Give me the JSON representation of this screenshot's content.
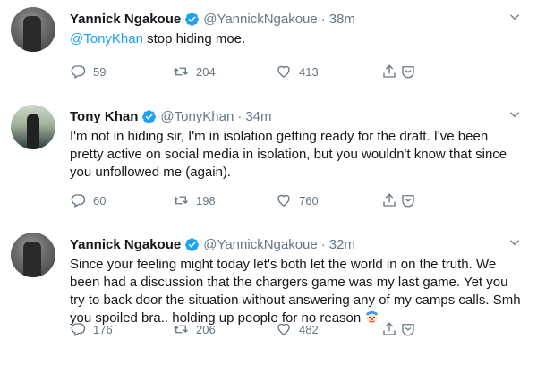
{
  "tweets": [
    {
      "name": "Yannick Ngakoue",
      "handle": "@YannickNgakoue",
      "separator": "·",
      "time": "38m",
      "mention": "@TonyKhan",
      "text": " stop hiding moe.",
      "replies": "59",
      "retweets": "204",
      "likes": "413"
    },
    {
      "name": "Tony Khan",
      "handle": "@TonyKhan",
      "separator": "·",
      "time": "34m",
      "text": "I'm not in hiding sir, I'm in isolation getting ready for the draft. I've been pretty active on social media in isolation, but you wouldn't know that since you unfollowed me (again).",
      "replies": "60",
      "retweets": "198",
      "likes": "760"
    },
    {
      "name": "Yannick Ngakoue",
      "handle": "@YannickNgakoue",
      "separator": "·",
      "time": "32m",
      "text": "Since your feeling might today let's both let the world in on the truth. We been had a discussion that the chargers game was my last game. Yet you try to back door the situation without answering any of my camps calls. Smh you spoiled bra.. holding up people for no reason ",
      "emoji": "clown-face-icon",
      "replies": "176",
      "retweets": "206",
      "likes": "482"
    }
  ],
  "colors": {
    "link": "#1da1f2",
    "secondary": "#657786",
    "verified": "#1da1f2",
    "divider": "#e6ecf0"
  }
}
